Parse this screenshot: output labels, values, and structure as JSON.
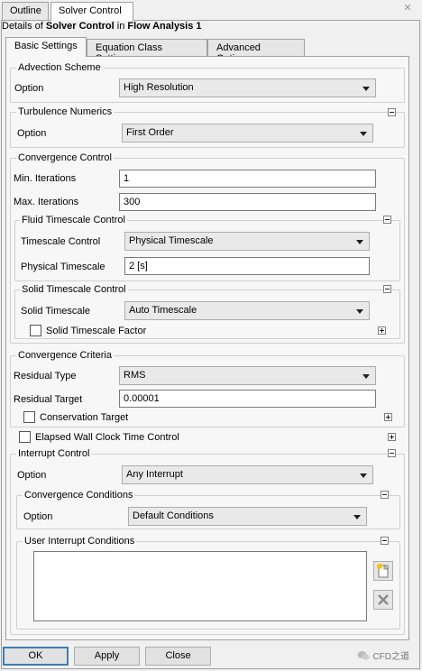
{
  "window_tabs": {
    "outline": "Outline",
    "solver_control": "Solver Control"
  },
  "details": {
    "prefix": "Details of",
    "object": "Solver Control",
    "in": "in",
    "parent": "Flow Analysis 1"
  },
  "subtabs": {
    "basic": "Basic Settings",
    "equation": "Equation Class Settings",
    "advanced": "Advanced Options"
  },
  "advection": {
    "title": "Advection Scheme",
    "option_label": "Option",
    "option_value": "High Resolution"
  },
  "turbulence": {
    "title": "Turbulence Numerics",
    "option_label": "Option",
    "option_value": "First Order"
  },
  "convergence_control": {
    "title": "Convergence Control",
    "min_label": "Min. Iterations",
    "min_value": "1",
    "max_label": "Max. Iterations",
    "max_value": "300"
  },
  "fluid_timescale": {
    "title": "Fluid Timescale Control",
    "control_label": "Timescale Control",
    "control_value": "Physical Timescale",
    "physical_label": "Physical Timescale",
    "physical_value": "2 [s]"
  },
  "solid_timescale": {
    "title": "Solid Timescale Control",
    "solid_label": "Solid Timescale",
    "solid_value": "Auto Timescale",
    "factor_label": "Solid Timescale Factor"
  },
  "convergence_criteria": {
    "title": "Convergence Criteria",
    "residual_type_label": "Residual Type",
    "residual_type_value": "RMS",
    "residual_target_label": "Residual Target",
    "residual_target_value": "0.00001",
    "conservation_label": "Conservation Target"
  },
  "elapsed": {
    "label": "Elapsed Wall Clock Time Control"
  },
  "interrupt": {
    "title": "Interrupt Control",
    "option_label": "Option",
    "option_value": "Any Interrupt",
    "conv_title": "Convergence Conditions",
    "conv_option_label": "Option",
    "conv_option_value": "Default Conditions",
    "user_title": "User Interrupt Conditions"
  },
  "buttons": {
    "ok": "OK",
    "apply": "Apply",
    "close": "Close"
  },
  "watermark": "CFD之道"
}
